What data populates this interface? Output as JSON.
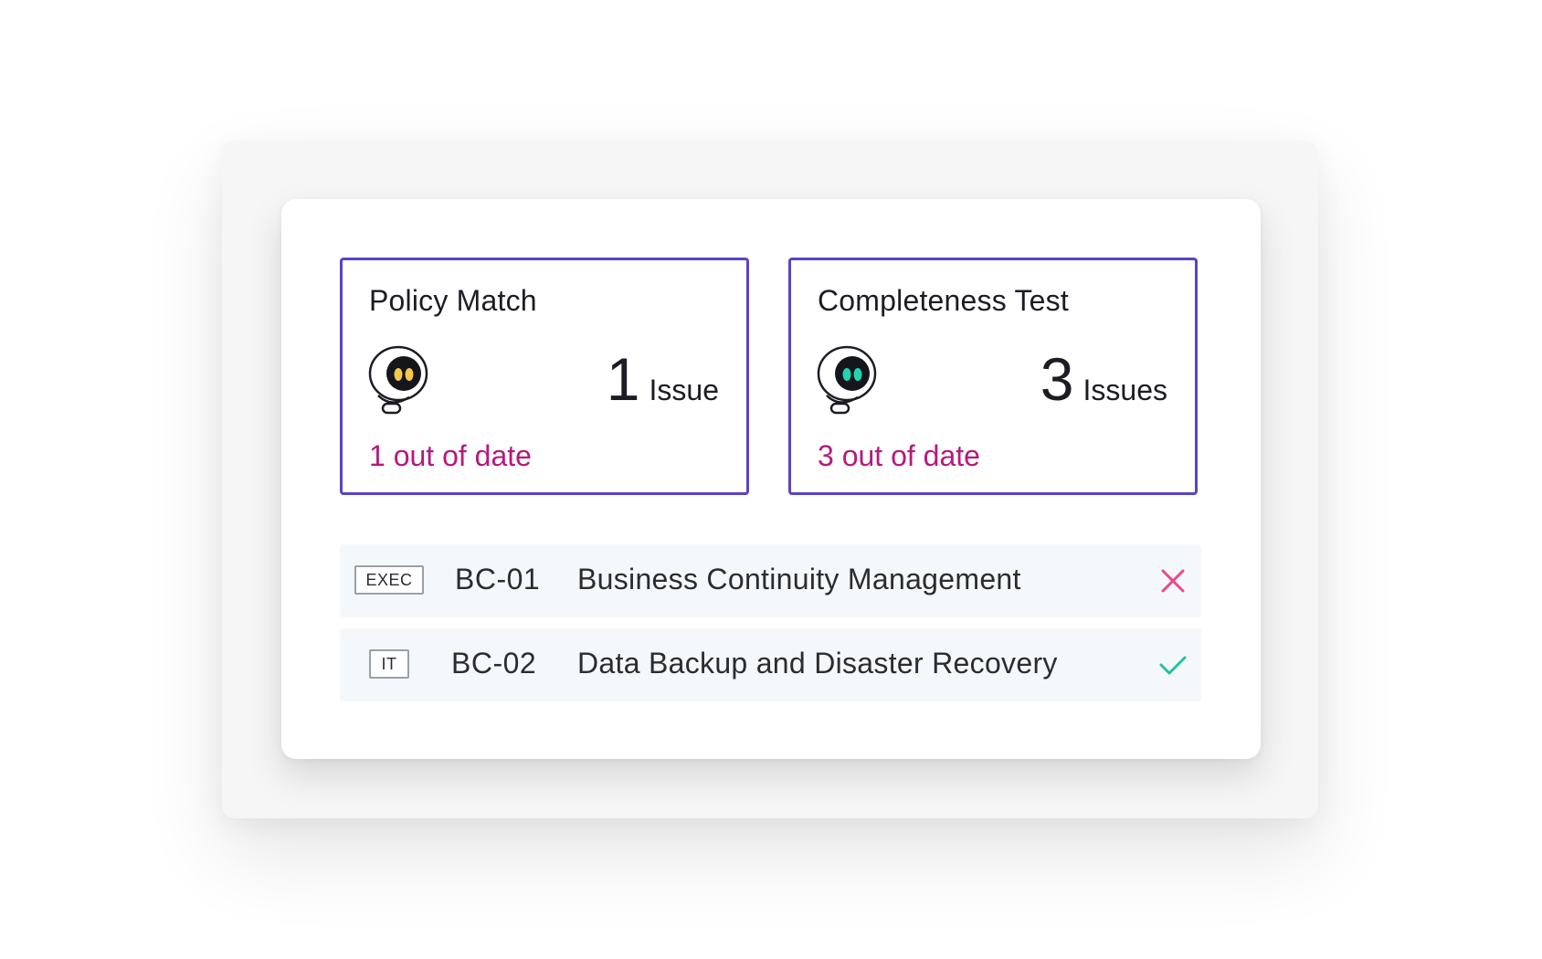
{
  "metrics": [
    {
      "title": "Policy Match",
      "issue_number": "1",
      "issue_label": "Issue",
      "out_of_date": "1 out of date",
      "eye_color": "#f2c94c"
    },
    {
      "title": "Completeness Test",
      "issue_number": "3",
      "issue_label": "Issues",
      "out_of_date": "3 out of date",
      "eye_color": "#1fd6b0"
    }
  ],
  "controls": [
    {
      "tag": "EXEC",
      "code": "BC-01",
      "name": "Business Continuity Management",
      "status": "fail",
      "status_icon": "close-icon",
      "status_color": "#f0468c"
    },
    {
      "tag": "IT",
      "code": "BC-02",
      "name": "Data Backup and Disaster Recovery",
      "status": "pass",
      "status_icon": "check-icon",
      "status_color": "#22c3a0"
    }
  ],
  "colors": {
    "card_border": "#5a43c8",
    "out_of_date_text": "#b5197e",
    "row_background": "#f5f8fb"
  }
}
